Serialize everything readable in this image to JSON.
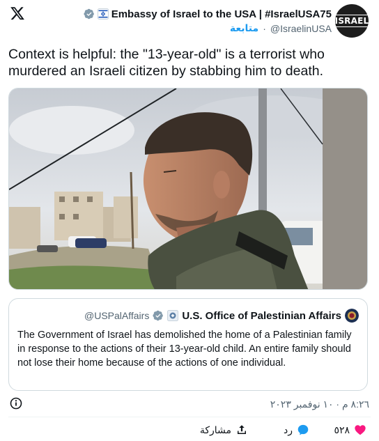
{
  "header": {
    "account_name": "Embassy of Israel to the USA | #IsraelUSA75",
    "handle": "@IsraelinUSA",
    "follow_label": "متابعة",
    "separator": "·",
    "avatar_text": "ISRAEL"
  },
  "tweet": {
    "text": "Context is helpful: the \"13-year-old\" is a terrorist who murdered an Israeli citizen by stabbing him to death."
  },
  "quote": {
    "account_name": "U.S. Office of Palestinian Affairs",
    "handle": "@USPalAffairs",
    "text": "The Government of Israel has demolished the home of a Palestinian family in response to the actions of their 13-year-old child. An entire family should not lose their home because of the actions of one individual."
  },
  "meta": {
    "timestamp": "٨:٢٦ م · ١٠ نوفمبر ٢٠٢٣"
  },
  "actions": {
    "likes_count": "٥٢٨",
    "reply_label": "رد",
    "share_label": "مشاركة"
  },
  "colors": {
    "accent": "#1d9bf0",
    "like": "#f91880",
    "verified_grey": "#829aab"
  }
}
